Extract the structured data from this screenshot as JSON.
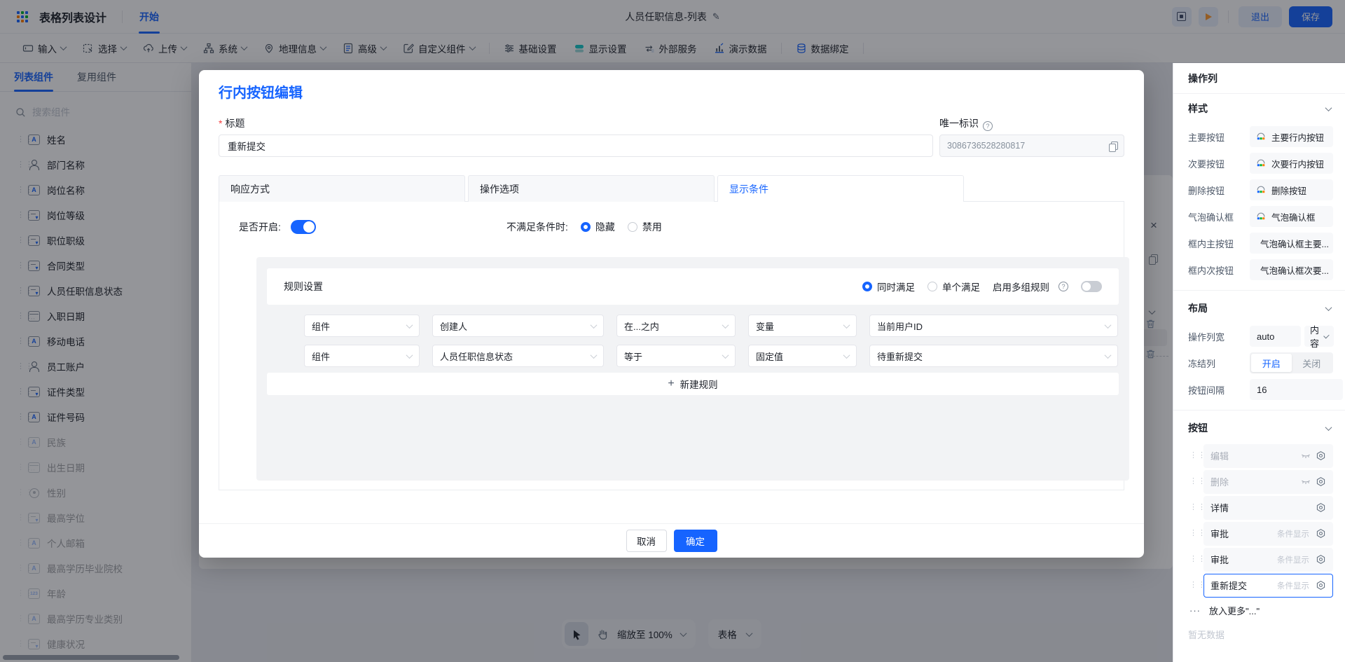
{
  "topbar": {
    "app_title": "表格列表设计",
    "start_tab": "开始",
    "page_title": "人员任职信息-列表",
    "exit_label": "退出",
    "save_label": "保存"
  },
  "toolbar": {
    "items": [
      {
        "label": "输入"
      },
      {
        "label": "选择"
      },
      {
        "label": "上传"
      },
      {
        "label": "系统"
      },
      {
        "label": "地理信息"
      },
      {
        "label": "高级"
      },
      {
        "label": "自定义组件"
      },
      {
        "label": "基础设置"
      },
      {
        "label": "显示设置"
      },
      {
        "label": "外部服务"
      },
      {
        "label": "演示数据"
      },
      {
        "label": "数据绑定"
      }
    ]
  },
  "sidebar": {
    "tabs": [
      {
        "label": "列表组件"
      },
      {
        "label": "复用组件"
      }
    ],
    "search_placeholder": "搜索组件",
    "items": [
      {
        "label": "姓名"
      },
      {
        "label": "部门名称"
      },
      {
        "label": "岗位名称"
      },
      {
        "label": "岗位等级"
      },
      {
        "label": "职位职级"
      },
      {
        "label": "合同类型"
      },
      {
        "label": "人员任职信息状态"
      },
      {
        "label": "入职日期"
      },
      {
        "label": "移动电话"
      },
      {
        "label": "员工账户"
      },
      {
        "label": "证件类型"
      },
      {
        "label": "证件号码"
      },
      {
        "label": "民族"
      },
      {
        "label": "出生日期"
      },
      {
        "label": "性别"
      },
      {
        "label": "最高学位"
      },
      {
        "label": "个人邮箱"
      },
      {
        "label": "最高学历毕业院校"
      },
      {
        "label": "年龄"
      },
      {
        "label": "最高学历专业类别"
      },
      {
        "label": "健康状况"
      }
    ]
  },
  "modal": {
    "title": "行内按钮编辑",
    "title_label": "标题",
    "title_value": "重新提交",
    "id_label": "唯一标识",
    "id_value": "3086736528280817",
    "tabs": [
      {
        "label": "响应方式"
      },
      {
        "label": "操作选项"
      },
      {
        "label": "显示条件"
      }
    ],
    "enabled_label": "是否开启:",
    "cond_label": "不满足条件时:",
    "cond_options": [
      {
        "label": "隐藏"
      },
      {
        "label": "禁用"
      }
    ],
    "rules": {
      "header": "规则设置",
      "match_all": "同时满足",
      "match_any": "单个满足",
      "multi_group": "启用多组规则",
      "rows": [
        {
          "c1": "组件",
          "c2": "创建人",
          "c3": "在...之内",
          "c4": "变量",
          "c5": "当前用户ID"
        },
        {
          "c1": "组件",
          "c2": "人员任职信息状态",
          "c3": "等于",
          "c4": "固定值",
          "c5": "待重新提交"
        }
      ],
      "add_label": "新建规则"
    },
    "cancel_label": "取消",
    "ok_label": "确定"
  },
  "rightpanel": {
    "header": "操作列",
    "style_section": {
      "title": "样式",
      "rows": [
        {
          "label": "主要按钮",
          "value": "主要行内按钮"
        },
        {
          "label": "次要按钮",
          "value": "次要行内按钮"
        },
        {
          "label": "删除按钮",
          "value": "删除按钮"
        },
        {
          "label": "气泡确认框",
          "value": "气泡确认框"
        },
        {
          "label": "框内主按钮",
          "value": "气泡确认框主要..."
        },
        {
          "label": "框内次按钮",
          "value": "气泡确认框次要..."
        }
      ]
    },
    "layout_section": {
      "title": "布局",
      "width_label": "操作列宽",
      "width_value": "auto",
      "width_mode": "内容",
      "freeze_label": "冻结列",
      "freeze_on": "开启",
      "freeze_off": "关闭",
      "gap_label": "按钮间隔",
      "gap_value": "16"
    },
    "button_section": {
      "title": "按钮",
      "badge": "条件显示",
      "rows": [
        {
          "label": "编辑"
        },
        {
          "label": "删除"
        },
        {
          "label": "详情"
        },
        {
          "label": "审批"
        },
        {
          "label": "审批"
        },
        {
          "label": "重新提交"
        }
      ],
      "more_label": "放入更多\"...\"",
      "empty_label": "暂无数据"
    }
  },
  "bottombar": {
    "zoom_label": "缩放至 100%",
    "view_label": "表格"
  },
  "glyphs": {
    "pencil": "✎",
    "close": "×",
    "more_dots": "···",
    "plus": "+",
    "help": "?"
  },
  "colors": {
    "accent": "#1664ff",
    "danger": "#f53f3f",
    "green": "#00b42a",
    "orange": "#ff7d00",
    "teal": "#14c9c9"
  }
}
